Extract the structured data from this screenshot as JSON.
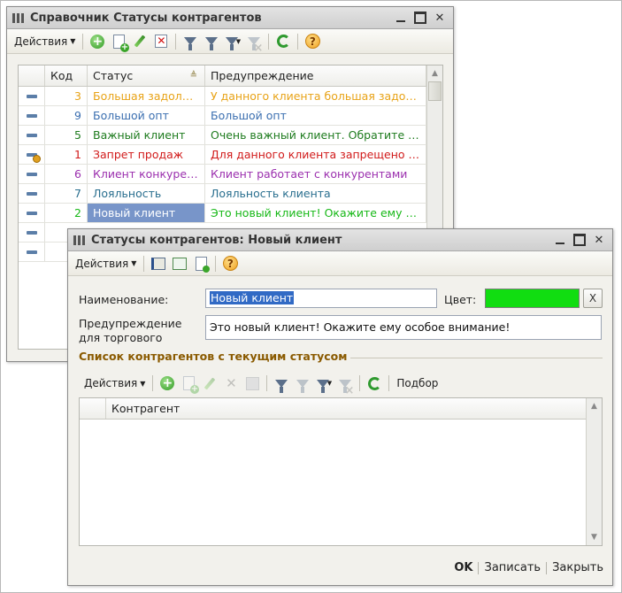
{
  "list_window": {
    "title": "Справочник Статусы контрагентов",
    "toolbar": {
      "actions_label": "Действия"
    },
    "columns": [
      "Код",
      "Статус",
      "Предупреждение"
    ],
    "rows": [
      {
        "code": "3",
        "status": "Большая задолже...",
        "warning": "У данного клиента большая задолж...",
        "color": "#e8a317",
        "marker": "warn-no"
      },
      {
        "code": "9",
        "status": "Большой опт",
        "warning": "Большой опт",
        "color": "#3b6fb0"
      },
      {
        "code": "5",
        "status": "Важный клиент",
        "warning": "Очень важный клиент. Обратите вн...",
        "color": "#1e7b1e"
      },
      {
        "code": "1",
        "status": "Запрет продаж",
        "warning": "Для данного клиента запрещено о...",
        "color": "#d11a1a"
      },
      {
        "code": "6",
        "status": "Клиент конкурен...",
        "warning": "Клиент работает с конкурентами",
        "color": "#9b2fae"
      },
      {
        "code": "7",
        "status": "Лояльность",
        "warning": "Лояльность клиента",
        "color": "#2a6f8f"
      },
      {
        "code": "2",
        "status": "Новый клиент",
        "warning": "Это новый клиент! Окажите ему ос...",
        "color": "#17b817"
      }
    ]
  },
  "item_window": {
    "title": "Статусы контрагентов: Новый клиент",
    "toolbar": {
      "actions_label": "Действия"
    },
    "name_label": "Наименование:",
    "name_value": "Новый клиент",
    "color_label": "Цвет:",
    "color_value": "#11dd11",
    "clear_label": "X",
    "warning_label_1": "Предупреждение",
    "warning_label_2": "для торгового",
    "warning_value": "Это новый клиент! Окажите ему особое внимание!",
    "section_title": "Список контрагентов с текущим статусом",
    "sub_toolbar": {
      "actions_label": "Действия",
      "pick_label": "Подбор"
    },
    "sub_grid_columns": [
      "Контрагент"
    ],
    "buttons": {
      "ok": "OK",
      "save": "Записать",
      "close": "Закрыть"
    }
  }
}
